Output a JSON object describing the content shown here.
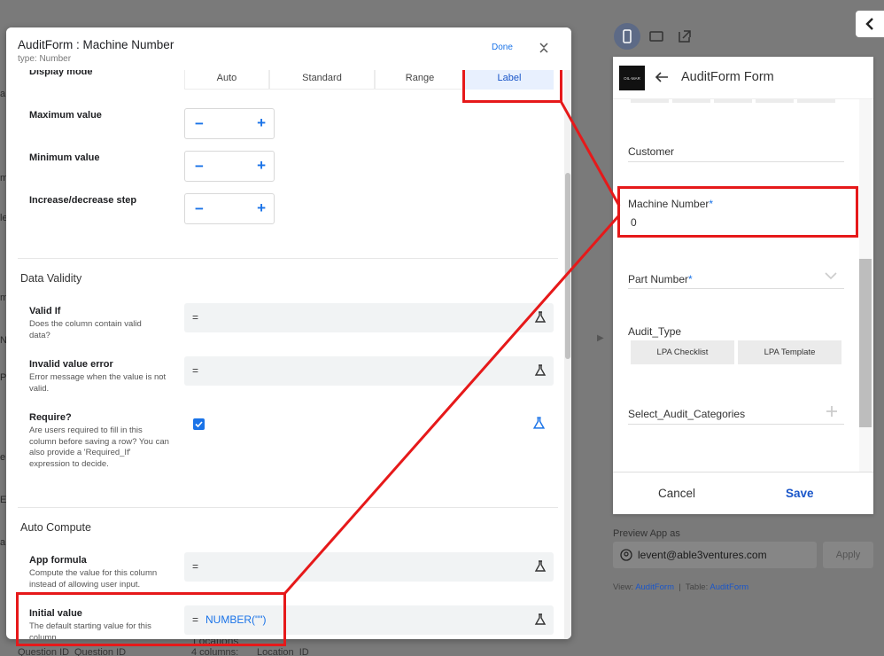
{
  "dialog": {
    "title": "AuditForm : Machine Number",
    "subtitle": "type: Number",
    "done_label": "Done",
    "display_mode": {
      "label": "Display mode",
      "options": [
        "Auto",
        "Standard",
        "Range",
        "Label"
      ],
      "selected": "Label"
    },
    "max_value_label": "Maximum value",
    "min_value_label": "Minimum value",
    "step_label": "Increase/decrease step",
    "stepper_minus": "−",
    "stepper_plus": "+",
    "data_validity": {
      "title": "Data Validity",
      "valid_if": {
        "label": "Valid If",
        "desc": "Does the column contain valid data?",
        "value": ""
      },
      "invalid_error": {
        "label": "Invalid value error",
        "desc": "Error message when the value is not valid.",
        "value": ""
      },
      "require": {
        "label": "Require?",
        "desc": "Are users required to fill in this column before saving a row? You can also provide a 'Required_If' expression to decide.",
        "checked": true
      }
    },
    "auto_compute": {
      "title": "Auto Compute",
      "app_formula": {
        "label": "App formula",
        "desc": "Compute the value for this column instead of allowing user input.",
        "value": ""
      },
      "initial_value": {
        "label": "Initial value",
        "desc": "The default starting value for this column.",
        "value": "NUMBER(\"\")"
      }
    },
    "eq_symbol": "="
  },
  "background": {
    "bottom_items": [
      "Question ID",
      "Question ID",
      "Locations",
      "4 columns:",
      "Location_ID"
    ]
  },
  "preview": {
    "logo_text": "OIL-MAR",
    "title": "AuditForm Form",
    "fields": [
      {
        "label": "Customer",
        "required": false,
        "value": ""
      },
      {
        "label": "Machine Number",
        "required": true,
        "value": "0"
      },
      {
        "label": "Part Number",
        "required": true,
        "value": ""
      },
      {
        "label": "Audit_Type",
        "required": false,
        "options": [
          "LPA Checklist",
          "LPA Template"
        ]
      },
      {
        "label": "Select_Audit_Categories",
        "required": false,
        "value": ""
      }
    ],
    "required_mark": "*",
    "cancel_label": "Cancel",
    "save_label": "Save",
    "preview_as_label": "Preview App as",
    "email": "levent@able3ventures.com",
    "apply_label": "Apply",
    "view_prefix": "View:",
    "view_value": "AuditForm",
    "table_prefix": "Table:",
    "table_value": "AuditForm"
  },
  "colors": {
    "accent": "#1a73e8",
    "annotation": "#e6191a"
  }
}
